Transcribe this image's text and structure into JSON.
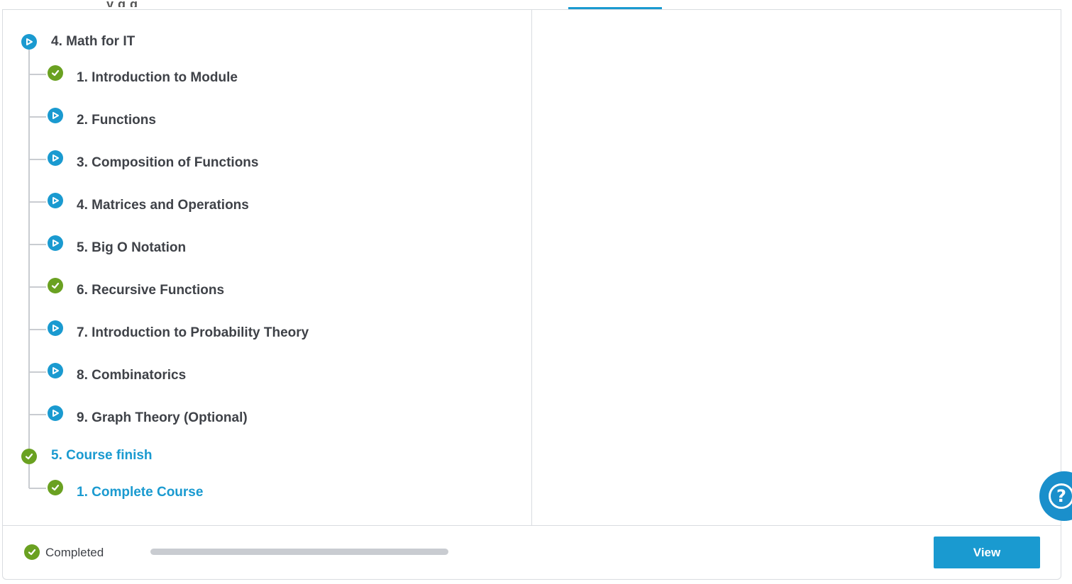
{
  "header": {
    "cut_off_text": "y                    g      g"
  },
  "course_tree": {
    "module": {
      "label": "4. Math for IT",
      "status": "play",
      "lessons": [
        {
          "label": "1. Introduction to Module",
          "status": "completed"
        },
        {
          "label": "2. Functions",
          "status": "play"
        },
        {
          "label": "3. Composition of Functions",
          "status": "play"
        },
        {
          "label": "4. Matrices and Operations",
          "status": "play"
        },
        {
          "label": "5. Big O Notation",
          "status": "play"
        },
        {
          "label": "6. Recursive Functions",
          "status": "completed"
        },
        {
          "label": "7. Introduction to Probability Theory",
          "status": "play"
        },
        {
          "label": "8. Combinatorics",
          "status": "play"
        },
        {
          "label": "9. Graph Theory (Optional)",
          "status": "play"
        }
      ]
    },
    "finish_module": {
      "label": "5. Course finish",
      "status": "completed",
      "lessons": [
        {
          "label": "1. Complete Course",
          "status": "completed"
        }
      ]
    }
  },
  "footer": {
    "status_label": "Completed",
    "progress_percent": 100,
    "view_button": "View"
  },
  "help": {
    "glyph": "?"
  },
  "colors": {
    "accent": "#1a9ad0",
    "success": "#6aa121",
    "text": "#3f4248",
    "track": "#c9ccd1"
  },
  "icons": {
    "play": "play-circle-icon",
    "completed": "check-circle-icon",
    "help": "help-icon"
  }
}
